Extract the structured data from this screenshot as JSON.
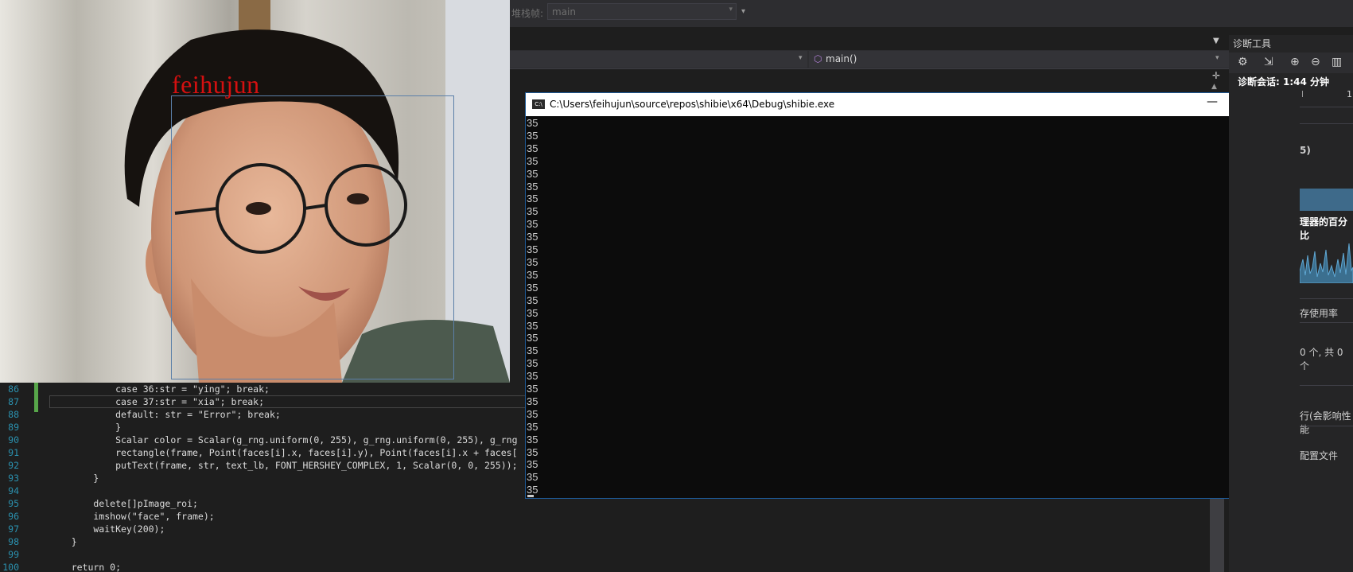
{
  "toolbar": {
    "stack_frame_label": "堆栈帧:",
    "stack_frame_value": "main"
  },
  "nav": {
    "function": "main()"
  },
  "webcam": {
    "label": "feihujun"
  },
  "code": {
    "lines": [
      {
        "n": "86",
        "text": "            case 36:str = \"ying\"; break;"
      },
      {
        "n": "87",
        "text": "            case 37:str = \"xia\"; break;"
      },
      {
        "n": "88",
        "text": "            default: str = \"Error\"; break;"
      },
      {
        "n": "89",
        "text": "            }"
      },
      {
        "n": "90",
        "text": "            Scalar color = Scalar(g_rng.uniform(0, 255), g_rng.uniform(0, 255), g_rng"
      },
      {
        "n": "91",
        "text": "            rectangle(frame, Point(faces[i].x, faces[i].y), Point(faces[i].x + faces["
      },
      {
        "n": "92",
        "text": "            putText(frame, str, text_lb, FONT_HERSHEY_COMPLEX, 1, Scalar(0, 0, 255));"
      },
      {
        "n": "93",
        "text": "        }"
      },
      {
        "n": "94",
        "text": ""
      },
      {
        "n": "95",
        "text": "        delete[]pImage_roi;"
      },
      {
        "n": "96",
        "text": "        imshow(\"face\", frame);"
      },
      {
        "n": "97",
        "text": "        waitKey(200);"
      },
      {
        "n": "98",
        "text": "    }"
      },
      {
        "n": "99",
        "text": ""
      },
      {
        "n": "100",
        "text": "    return 0;"
      }
    ]
  },
  "console": {
    "title": "C:\\Users\\feihujun\\source\\repos\\shibie\\x64\\Debug\\shibie.exe",
    "icon_text": "C:\\",
    "output": [
      "35",
      "35",
      "35",
      "35",
      "35",
      "35",
      "35",
      "35",
      "35",
      "35",
      "35",
      "35",
      "35",
      "35",
      "35",
      "35",
      "35",
      "35",
      "35",
      "35",
      "35",
      "35",
      "35",
      "35",
      "35",
      "35",
      "35",
      "35",
      "35",
      "35"
    ]
  },
  "diagnostics": {
    "title": "诊断工具",
    "session": "诊断会话: 1:44 分钟",
    "tick_label": "1",
    "events_label": "5)",
    "cpu_title": "理器的百分比",
    "memory_label": "存使用率",
    "count_label": "0 个, 共 0 个",
    "perf_label": "行(会影响性能",
    "profile_label": "配置文件"
  },
  "colors": {
    "console_bg": "#0c0c0c",
    "editor_bg": "#1e1e1e",
    "webcam_text": "#d41010",
    "accent": "#1e5a96"
  }
}
